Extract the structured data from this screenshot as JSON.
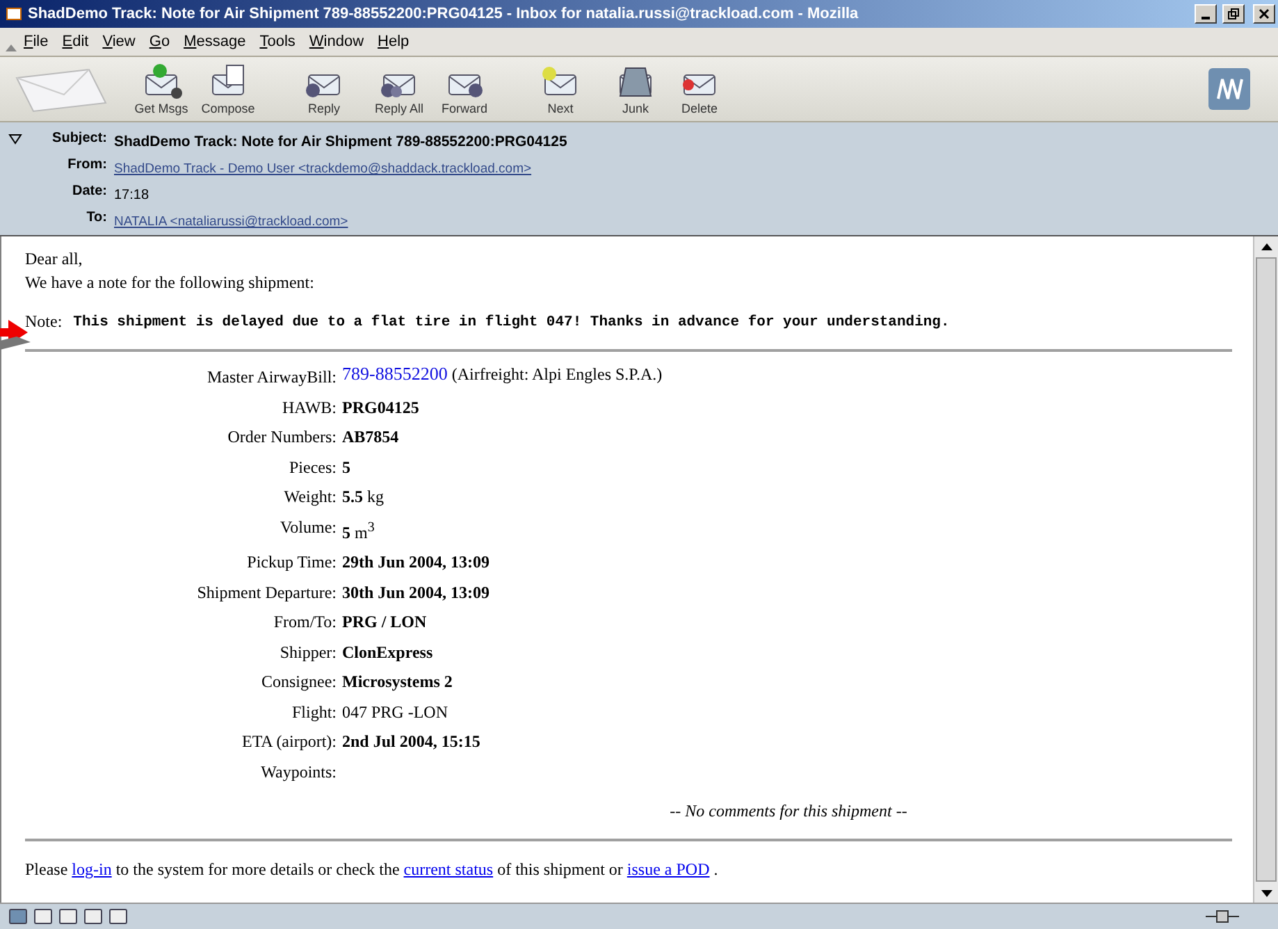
{
  "window": {
    "title": "ShadDemo Track: Note for Air Shipment 789-88552200:PRG04125 - Inbox for natalia.russi@trackload.com - Mozilla"
  },
  "menu": [
    "File",
    "Edit",
    "View",
    "Go",
    "Message",
    "Tools",
    "Window",
    "Help"
  ],
  "toolbar": [
    {
      "label": "Get Msgs",
      "kind": "get"
    },
    {
      "label": "Compose",
      "kind": "compose"
    },
    {
      "label": "Reply",
      "kind": "reply"
    },
    {
      "label": "Reply All",
      "kind": "replyall"
    },
    {
      "label": "Forward",
      "kind": "forward"
    },
    {
      "label": "Next",
      "kind": "next"
    },
    {
      "label": "Junk",
      "kind": "junk"
    },
    {
      "label": "Delete",
      "kind": "delete"
    }
  ],
  "header": {
    "expanded": true,
    "fields": [
      {
        "label": "Subject:",
        "value": "ShadDemo Track: Note for Air Shipment 789-88552200:PRG04125",
        "kind": "bold"
      },
      {
        "label": "From:",
        "value": "ShadDemo Track - Demo User <trackdemo@shaddack.trackload.com>",
        "kind": "link"
      },
      {
        "label": "Date:",
        "value": "17:18",
        "kind": "text"
      },
      {
        "label": "To:",
        "value": "NATALIA <nataliarussi@trackload.com>",
        "kind": "link"
      }
    ]
  },
  "body": {
    "greeting": "Dear all,",
    "intro": "We have a note for the following shipment:",
    "note_label": "Note:",
    "note": "This shipment is delayed due to a flat tire in flight 047! Thanks in advance for your understanding.",
    "details": [
      {
        "label": "Master AirwayBill:",
        "value": "789-88552200",
        "kind": "link",
        "extra": "(Airfreight: Alpi Engles S.P.A.)"
      },
      {
        "label": "HAWB:",
        "value": "PRG04125",
        "kind": "bold"
      },
      {
        "label": "Order Numbers:",
        "value": "AB7854",
        "kind": "bold"
      },
      {
        "label": "Pieces:",
        "value": "5",
        "kind": "bold"
      },
      {
        "label": "Weight:",
        "value": "**5.5** kg",
        "kind": "rich"
      },
      {
        "label": "Volume:",
        "value": "**5** m$^{3}$",
        "kind": "rich"
      },
      {
        "label": "Pickup Time:",
        "value": "29th Jun 2004, 13:09",
        "kind": "bold"
      },
      {
        "label": "Shipment Departure:",
        "value": "30th Jun 2004, 13:09",
        "kind": "bold"
      },
      {
        "label": "From/To:",
        "value": "PRG / LON",
        "kind": "bold"
      },
      {
        "label": "Shipper:",
        "value": "ClonExpress",
        "kind": "bold"
      },
      {
        "label": "Consignee:",
        "value": "Microsystems 2",
        "kind": "bold"
      },
      {
        "label": "Flight:",
        "value": "047 PRG -LON",
        "kind": "text"
      },
      {
        "label": "ETA (airport):",
        "value": "2nd Jul 2004, 15:15",
        "kind": "bold"
      },
      {
        "label": "Waypoints:",
        "kind": "empty"
      }
    ],
    "comments": "-- No comments for this shipment --",
    "footer": [
      {
        "text": "Please",
        "kind": "text"
      },
      {
        "text": "log-in",
        "kind": "link"
      },
      {
        "text": "to the system for more details or check the",
        "kind": "text"
      },
      {
        "text": "current status",
        "kind": "link"
      },
      {
        "text": "of this shipment or",
        "kind": "text"
      },
      {
        "text": "issue a POD",
        "kind": "link"
      },
      {
        "text": ".",
        "kind": "text"
      }
    ]
  }
}
